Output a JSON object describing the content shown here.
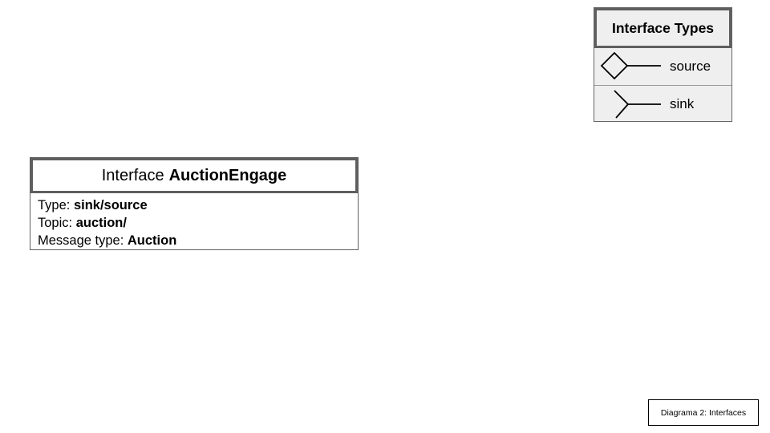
{
  "interface_card": {
    "prefix": "Interface",
    "name": "AuctionEngage",
    "fields": [
      {
        "label": "Type:",
        "value": "sink/source"
      },
      {
        "label": "Topic:",
        "value": "auction/"
      },
      {
        "label": "Message type:",
        "value": "Auction"
      }
    ]
  },
  "legend": {
    "title": "Interface Types",
    "items": [
      {
        "label": "source",
        "icon": "diamond-line-icon"
      },
      {
        "label": "sink",
        "icon": "fork-line-icon"
      }
    ]
  },
  "caption": "Diagrama 2: Interfaces"
}
